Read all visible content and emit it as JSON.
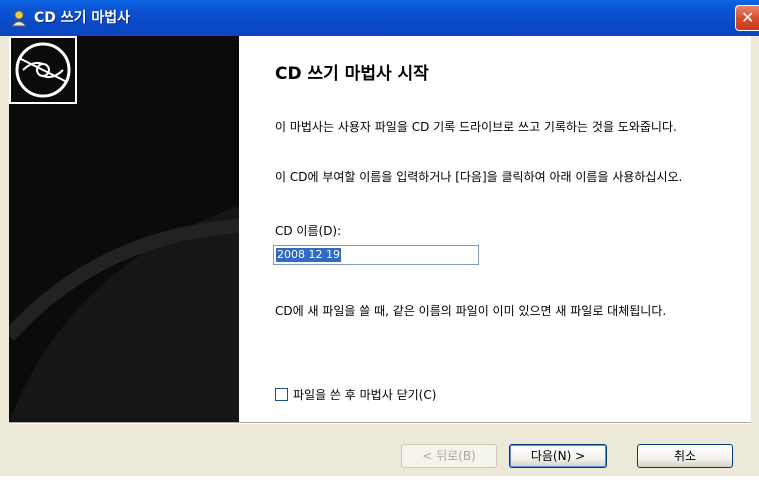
{
  "window": {
    "title": "CD 쓰기 마법사",
    "close_glyph": "✕"
  },
  "content": {
    "heading": "CD 쓰기 마법사 시작",
    "paragraph1": "이 마법사는 사용자 파일을 CD 기록 드라이브로 쓰고 기록하는 것을 도와줍니다.",
    "paragraph2": "이 CD에 부여할 이름을 입력하거나 [다음]을 클릭하여 아래 이름을 사용하십시오.",
    "cd_name_label": "CD 이름(D):",
    "cd_name_value": "2008 12 19",
    "paragraph3": "CD에 새 파일을 쓸 때, 같은 이름의 파일이 이미 있으면 새 파일로 대체됩니다.",
    "checkbox_label": "파일을 쓴 후 마법사 닫기(C)",
    "checkbox_checked": false
  },
  "buttons": {
    "back": "< 뒤로(B)",
    "next": "다음(N) >",
    "cancel": "취소"
  },
  "icons": {
    "title": "cd-writer-icon",
    "panel": "cd-disc-icon"
  }
}
